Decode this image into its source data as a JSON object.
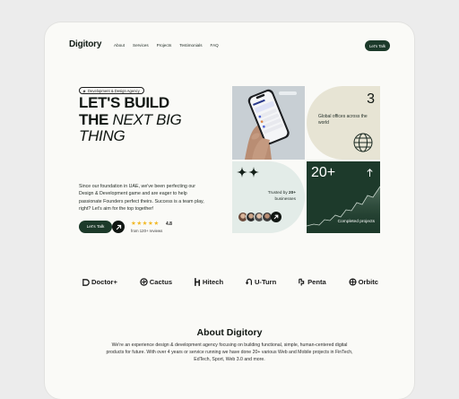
{
  "nav": {
    "logo": "Digitory",
    "items": [
      "About",
      "Services",
      "Projects",
      "Testimonials",
      "FAQ"
    ],
    "cta": "Let's Talk"
  },
  "hero": {
    "tag": "Development & Design Agency",
    "headline": {
      "line1": "LET'S BUILD",
      "line2_a": "THE ",
      "line2_b": "NEXT BIG",
      "line3": "THING"
    },
    "paragraph": "Since our foundation in UAE, we've been perfecting our Design & Development game and are eager to help passionate Founders perfect theirs. Success is a team play, right? Let's aim for the top together!",
    "cta": "Let's Talk",
    "rating": {
      "value": "4.8",
      "stars": 5,
      "reviews": "from 120+ reviews"
    }
  },
  "tiles": {
    "offices": {
      "count": "3",
      "text": "Global offices across the world"
    },
    "trusted": {
      "prefix": "Trusted by ",
      "count": "20+",
      "suffix": " businesses"
    },
    "done": {
      "count": "20+",
      "label": "Completed projects"
    }
  },
  "brands": [
    {
      "name": "Doctor+",
      "icon": "doctor-logo-icon"
    },
    {
      "name": "Cactus",
      "icon": "cactus-logo-icon"
    },
    {
      "name": "Hitech",
      "icon": "hitech-logo-icon"
    },
    {
      "name": "U-Turn",
      "icon": "uturn-logo-icon"
    },
    {
      "name": "Penta",
      "icon": "penta-logo-icon"
    },
    {
      "name": "Orbitc",
      "icon": "orbitc-logo-icon"
    }
  ],
  "about": {
    "title": "About Digitory",
    "text": "We're an experience design & development agency focusing on building functional, simple, human-centered digital products for future. With over 4 years or service running we have done 20+ various Web and Mobile projects in FinTech, EdTech, Sport, Web 3.0 and more."
  },
  "colors": {
    "primary": "#1c3a2a",
    "accent_star": "#f2b824",
    "background": "#fafaf7"
  }
}
